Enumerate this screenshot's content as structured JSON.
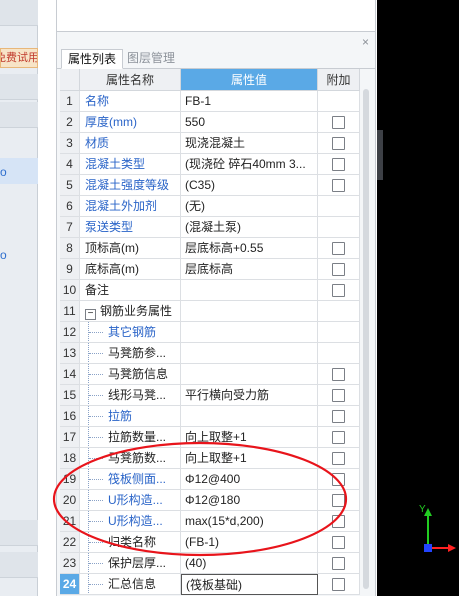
{
  "left_strip": {
    "trial_label": "免费试用",
    "char1": "o",
    "char2": "o"
  },
  "panel": {
    "close_icon": "×",
    "tabs": [
      {
        "label": "属性列表"
      },
      {
        "label": "图层管理"
      }
    ]
  },
  "grid": {
    "headers": {
      "name": "属性名称",
      "value": "属性值",
      "extra": "附加"
    },
    "rows": [
      {
        "num": "1",
        "name": "名称",
        "value": "FB-1",
        "style": "blue",
        "checkbox": false
      },
      {
        "num": "2",
        "name": "厚度(mm)",
        "value": "550",
        "style": "blue",
        "checkbox": true
      },
      {
        "num": "3",
        "name": "材质",
        "value": "现浇混凝土",
        "style": "blue",
        "checkbox": true
      },
      {
        "num": "4",
        "name": "混凝土类型",
        "value": "(现浇砼 碎石40mm 3...",
        "style": "blue",
        "checkbox": true
      },
      {
        "num": "5",
        "name": "混凝土强度等级",
        "value": "(C35)",
        "style": "blue",
        "checkbox": true
      },
      {
        "num": "6",
        "name": "混凝土外加剂",
        "value": "(无)",
        "style": "blue",
        "checkbox": false
      },
      {
        "num": "7",
        "name": "泵送类型",
        "value": "(混凝土泵)",
        "style": "blue",
        "checkbox": false
      },
      {
        "num": "8",
        "name": "顶标高(m)",
        "value": "层底标高+0.55",
        "style": "black",
        "checkbox": true
      },
      {
        "num": "9",
        "name": "底标高(m)",
        "value": "层底标高",
        "style": "black",
        "checkbox": true
      },
      {
        "num": "10",
        "name": "备注",
        "value": "",
        "style": "black",
        "checkbox": true
      },
      {
        "num": "11",
        "name": "钢筋业务属性",
        "value": "",
        "style": "black",
        "checkbox": false,
        "group": true,
        "expander": "−"
      },
      {
        "num": "12",
        "name": "其它钢筋",
        "value": "",
        "style": "blue",
        "checkbox": false,
        "child": true
      },
      {
        "num": "13",
        "name": "马凳筋参...",
        "value": "",
        "style": "black",
        "checkbox": false,
        "child": true
      },
      {
        "num": "14",
        "name": "马凳筋信息",
        "value": "",
        "style": "black",
        "checkbox": true,
        "child": true
      },
      {
        "num": "15",
        "name": "线形马凳...",
        "value": "平行横向受力筋",
        "style": "black",
        "checkbox": true,
        "child": true
      },
      {
        "num": "16",
        "name": "拉筋",
        "value": "",
        "style": "blue",
        "checkbox": true,
        "child": true
      },
      {
        "num": "17",
        "name": "拉筋数量...",
        "value": "向上取整+1",
        "style": "black",
        "checkbox": true,
        "child": true
      },
      {
        "num": "18",
        "name": "马凳筋数...",
        "value": "向上取整+1",
        "style": "black",
        "checkbox": true,
        "child": true
      },
      {
        "num": "19",
        "name": "筏板侧面...",
        "value": "Φ12@400",
        "style": "blue",
        "checkbox": true,
        "child": true
      },
      {
        "num": "20",
        "name": "U形构造...",
        "value": "Φ12@180",
        "style": "blue",
        "checkbox": true,
        "child": true
      },
      {
        "num": "21",
        "name": "U形构造...",
        "value": "max(15*d,200)",
        "style": "blue",
        "checkbox": true,
        "child": true
      },
      {
        "num": "22",
        "name": "归类名称",
        "value": "(FB-1)",
        "style": "black",
        "checkbox": true,
        "child": true
      },
      {
        "num": "23",
        "name": "保护层厚...",
        "value": "(40)",
        "style": "black",
        "checkbox": true,
        "child": true
      },
      {
        "num": "24",
        "name": "汇总信息",
        "value": "(筏板基础)",
        "style": "black",
        "checkbox": true,
        "child": true,
        "selected": true
      }
    ]
  },
  "annotation": {
    "color": "#e8141b"
  },
  "axis": {
    "y_label": "Y",
    "x_color": "#ff2222",
    "y_color": "#22cc22",
    "origin_color": "#2244ff"
  }
}
